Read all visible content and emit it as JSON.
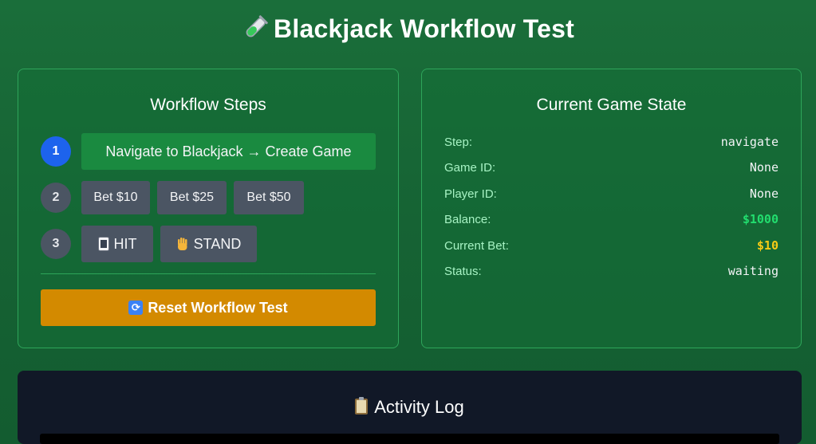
{
  "header": {
    "icon": "test-tube-icon",
    "title": "Blackjack Workflow Test"
  },
  "workflow": {
    "title": "Workflow Steps",
    "steps": [
      {
        "number": "1",
        "active": true,
        "buttons": [
          "Navigate to Blackjack → Create Game"
        ]
      },
      {
        "number": "2",
        "active": false,
        "buttons": [
          "Bet $10",
          "Bet $25",
          "Bet $50"
        ]
      },
      {
        "number": "3",
        "active": false,
        "buttons": [
          "HIT",
          "STAND"
        ]
      }
    ],
    "hit_icon": "playing-card-icon",
    "stand_icon": "raised-hand-icon",
    "reset_label": "Reset Workflow Test",
    "reset_icon": "refresh-icon"
  },
  "game_state": {
    "title": "Current Game State",
    "rows": [
      {
        "label": "Step:",
        "value": "navigate"
      },
      {
        "label": "Game ID:",
        "value": "None"
      },
      {
        "label": "Player ID:",
        "value": "None"
      },
      {
        "label": "Balance:",
        "value": "$1000"
      },
      {
        "label": "Current Bet:",
        "value": "$10"
      },
      {
        "label": "Status:",
        "value": "waiting"
      }
    ]
  },
  "log": {
    "icon": "clipboard-icon",
    "title": "Activity Log"
  },
  "colors": {
    "background": "#166334",
    "active_step": "#1d63ed",
    "primary_button": "#1a8a40",
    "reset_button": "#d38a00",
    "balance": "#22dd6e",
    "bet": "#facc15",
    "log_panel": "#111827"
  }
}
